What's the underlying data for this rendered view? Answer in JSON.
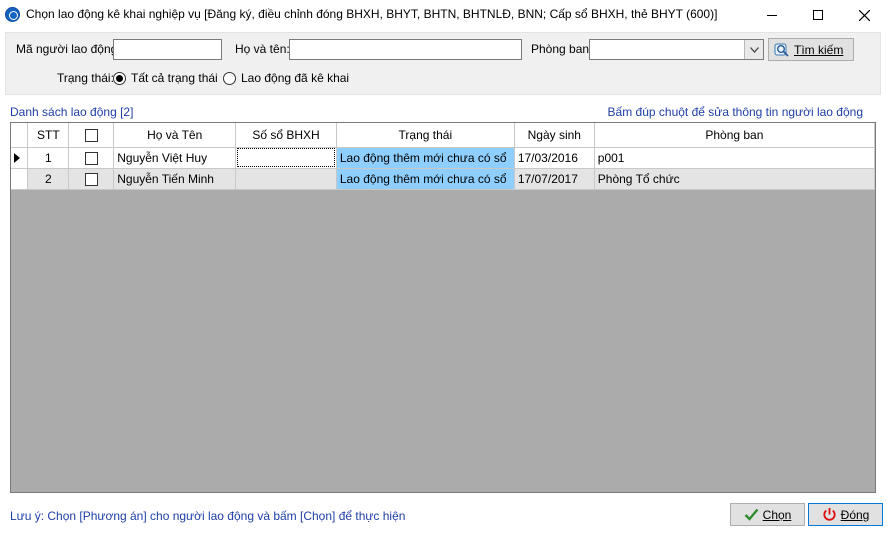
{
  "window": {
    "title": "Chọn lao động kê khai nghiệp vụ [Đăng ký, điều chỉnh đóng BHXH, BHYT, BHTN, BHTNLĐ, BNN; Cấp sổ BHXH, thẻ BHYT (600)]"
  },
  "filters": {
    "employee_code_label": "Mã người lao động:",
    "employee_code_value": "",
    "fullname_label": "Họ và tên:",
    "fullname_value": "",
    "department_label": "Phòng ban:",
    "department_value": "",
    "search_button": "Tìm kiếm",
    "status_label": "Trạng thái:",
    "status_options": [
      "Tất cả trạng thái",
      "Lao động đã kê khai"
    ],
    "status_selected": "Tất cả trạng thái"
  },
  "list": {
    "title": "Danh sách lao động [2]",
    "hint": "Bấm đúp chuột để sửa thông tin người lao động",
    "columns": [
      "STT",
      "",
      "Họ và Tên",
      "Số sổ BHXH",
      "Trạng thái",
      "Ngày sinh",
      "Phòng ban"
    ],
    "rows": [
      {
        "stt": "1",
        "checked": false,
        "name": "Nguyễn Việt Huy",
        "so_bhxh": "",
        "status": "Lao động thêm mới chưa có sổ",
        "dob": "17/03/2016",
        "department": "p001"
      },
      {
        "stt": "2",
        "checked": false,
        "name": "Nguyễn Tiến Minh",
        "so_bhxh": "",
        "status": "Lao động thêm mới chưa có sổ",
        "dob": "17/07/2017",
        "department": "Phòng Tổ chức"
      }
    ]
  },
  "footer": {
    "note": "Lưu ý: Chọn [Phương án] cho người lao động và bấm [Chọn] để thực hiện",
    "choose_button": "Chọn",
    "close_button": "Đóng"
  },
  "colors": {
    "link_blue": "#1f3fa6",
    "status_highlight": "#8ecfff",
    "grid_background": "#ababab"
  }
}
